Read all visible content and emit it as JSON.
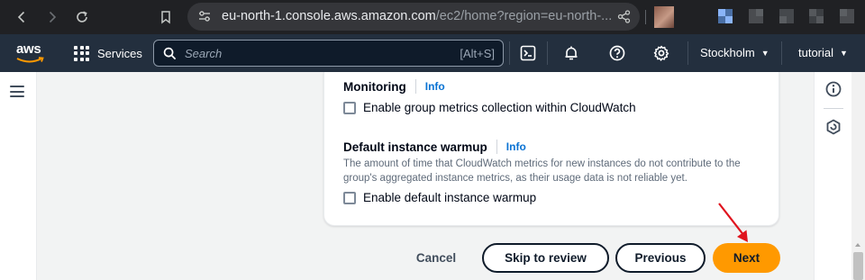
{
  "browser": {
    "url_host": "eu-north-1.console.aws.amazon.com",
    "url_path": "/ec2/home?region=eu-north-..."
  },
  "header": {
    "logo": "aws",
    "services_label": "Services",
    "search_placeholder": "Search",
    "search_shortcut": "[Alt+S]",
    "region_label": "Stockholm",
    "account_label": "tutorial",
    "icons": [
      "cloudshell-icon",
      "notifications-bell-icon",
      "help-icon",
      "settings-gear-icon"
    ]
  },
  "monitoring": {
    "label": "Monitoring",
    "info": "Info",
    "checkbox_label": "Enable group metrics collection within CloudWatch",
    "checked": false
  },
  "warmup": {
    "label": "Default instance warmup",
    "info": "Info",
    "description": "The amount of time that CloudWatch metrics for new instances do not contribute to the group's aggregated instance metrics, as their usage data is not reliable yet.",
    "checkbox_label": "Enable default instance warmup",
    "checked": false
  },
  "footer": {
    "cancel": "Cancel",
    "skip": "Skip to review",
    "previous": "Previous",
    "next": "Next"
  },
  "colors": {
    "primary_button": "#ff9900",
    "header_bg": "#232f3e",
    "link": "#0972d3",
    "annotation_arrow": "#e0141e"
  }
}
